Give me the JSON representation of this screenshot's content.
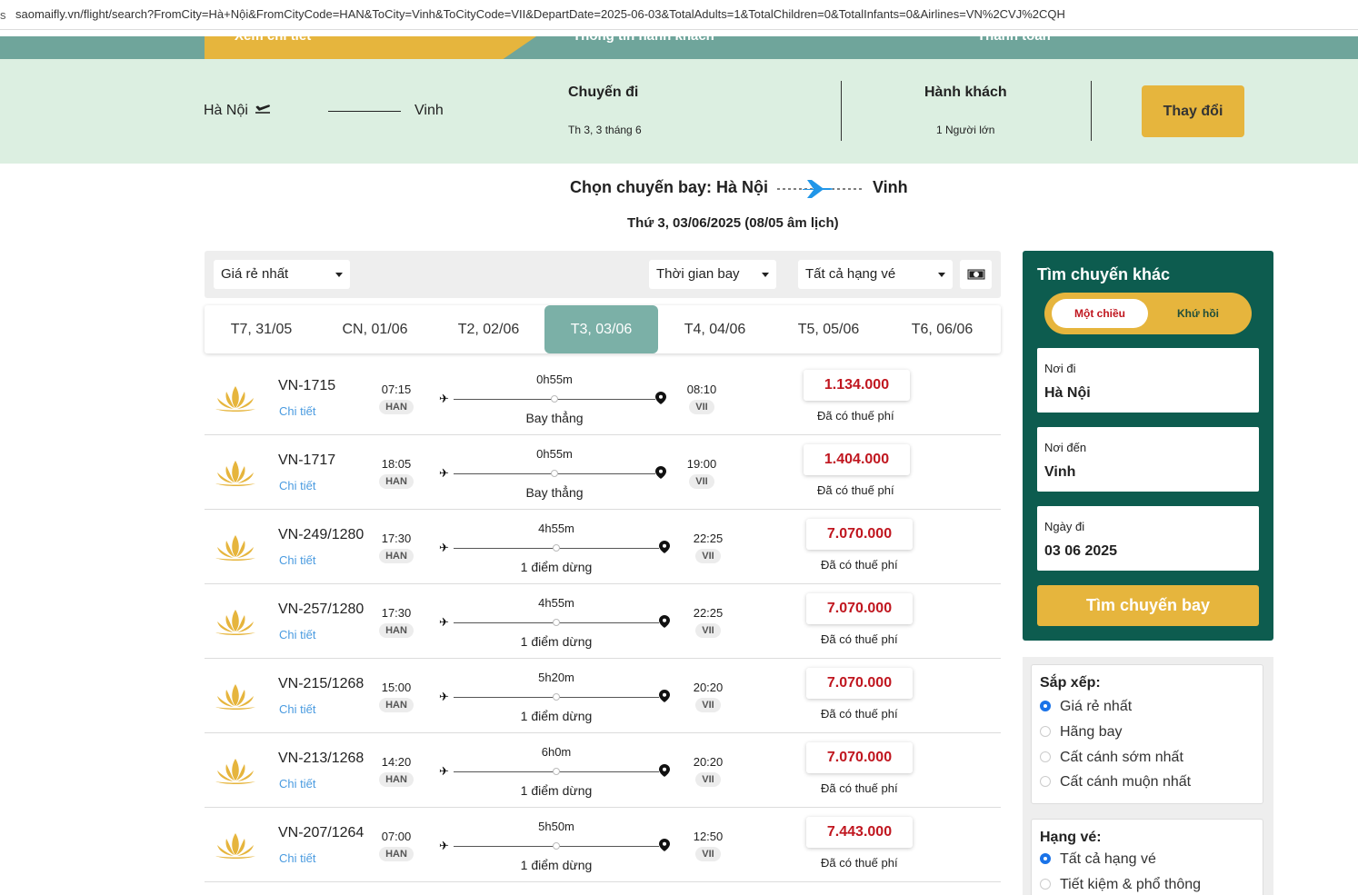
{
  "browser": {
    "url_fragment": "s",
    "url": "saomaifly.vn/flight/search?FromCity=Hà+Nội&FromCityCode=HAN&ToCity=Vinh&ToCityCode=VII&DepartDate=2025-06-03&TotalAdults=1&TotalChildren=0&TotalInfants=0&Airlines=VN%2CVJ%2CQH"
  },
  "steps": [
    "Xem chi tiết",
    "Thông tin hành khách",
    "Thanh toán"
  ],
  "summary": {
    "from": "Hà Nội",
    "to": "Vinh",
    "trip_title": "Chuyến đi",
    "trip_date": "Th 3, 3 tháng 6",
    "pax_title": "Hành khách",
    "pax_value": "1 Người lớn",
    "change_label": "Thay đổi"
  },
  "headline": {
    "prefix": "Chọn chuyến bay: Hà Nội",
    "dest": "Vinh",
    "date": "Thứ 3, 03/06/2025 (08/05 âm lịch)"
  },
  "filters": {
    "sort_value": "Giá rẻ nhất",
    "time_value": "Thời gian bay",
    "class_value": "Tất cả hạng vé"
  },
  "date_tabs": [
    "T7, 31/05",
    "CN, 01/06",
    "T2, 02/06",
    "T3, 03/06",
    "T4, 04/06",
    "T5, 05/06",
    "T6, 06/06"
  ],
  "active_date_index": 3,
  "flights": [
    {
      "number": "VN-1715",
      "detail": "Chi tiết",
      "dep_time": "07:15",
      "dep_code": "HAN",
      "duration": "0h55m",
      "stops": "Bay thẳng",
      "arr_time": "08:10",
      "arr_code": "VII",
      "price": "1.134.000",
      "tax": "Đã có thuế phí"
    },
    {
      "number": "VN-1717",
      "detail": "Chi tiết",
      "dep_time": "18:05",
      "dep_code": "HAN",
      "duration": "0h55m",
      "stops": "Bay thẳng",
      "arr_time": "19:00",
      "arr_code": "VII",
      "price": "1.404.000",
      "tax": "Đã có thuế phí"
    },
    {
      "number": "VN-249/1280",
      "detail": "Chi tiết",
      "dep_time": "17:30",
      "dep_code": "HAN",
      "duration": "4h55m",
      "stops": "1 điểm dừng",
      "arr_time": "22:25",
      "arr_code": "VII",
      "price": "7.070.000",
      "tax": "Đã có thuế phí"
    },
    {
      "number": "VN-257/1280",
      "detail": "Chi tiết",
      "dep_time": "17:30",
      "dep_code": "HAN",
      "duration": "4h55m",
      "stops": "1 điểm dừng",
      "arr_time": "22:25",
      "arr_code": "VII",
      "price": "7.070.000",
      "tax": "Đã có thuế phí"
    },
    {
      "number": "VN-215/1268",
      "detail": "Chi tiết",
      "dep_time": "15:00",
      "dep_code": "HAN",
      "duration": "5h20m",
      "stops": "1 điểm dừng",
      "arr_time": "20:20",
      "arr_code": "VII",
      "price": "7.070.000",
      "tax": "Đã có thuế phí"
    },
    {
      "number": "VN-213/1268",
      "detail": "Chi tiết",
      "dep_time": "14:20",
      "dep_code": "HAN",
      "duration": "6h0m",
      "stops": "1 điểm dừng",
      "arr_time": "20:20",
      "arr_code": "VII",
      "price": "7.070.000",
      "tax": "Đã có thuế phí"
    },
    {
      "number": "VN-207/1264",
      "detail": "Chi tiết",
      "dep_time": "07:00",
      "dep_code": "HAN",
      "duration": "5h50m",
      "stops": "1 điểm dừng",
      "arr_time": "12:50",
      "arr_code": "VII",
      "price": "7.443.000",
      "tax": "Đã có thuế phí"
    }
  ],
  "search": {
    "title": "Tìm chuyến khác",
    "oneway": "Một chiều",
    "roundtrip": "Khứ hồi",
    "from_label": "Nơi đi",
    "from_value": "Hà Nội",
    "to_label": "Nơi đến",
    "to_value": "Vinh",
    "date_label": "Ngày đi",
    "date_value": "03 06 2025",
    "button": "Tìm chuyến bay"
  },
  "sort_box": {
    "title": "Sắp xếp:",
    "options": [
      "Giá rẻ nhất",
      "Hãng bay",
      "Cất cánh sớm nhất",
      "Cất cánh muộn nhất"
    ],
    "selected": 0
  },
  "class_box": {
    "title": "Hạng vé:",
    "options": [
      "Tất cả hạng vé",
      "Tiết kiệm & phổ thông"
    ],
    "selected": 0
  },
  "colors": {
    "brand_green": "#0d5c4f",
    "accent_gold": "#e6b53d",
    "price_red": "#c0161f",
    "active_tab": "#7bb0a7",
    "summary_bg": "#dcefe1",
    "link_blue": "#4a9be0"
  },
  "icons": {
    "plane_takeoff": "airplane-takeoff-icon",
    "route_plane": "plane-icon",
    "dest_pin": "map-pin-icon",
    "money": "money-icon",
    "airline_logo": "lotus-logo-icon"
  }
}
